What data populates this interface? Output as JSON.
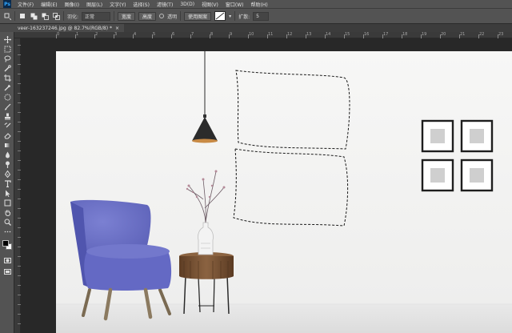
{
  "menu": {
    "logo": "Ps",
    "items": [
      "文件(F)",
      "编辑(E)",
      "图像(I)",
      "图层(L)",
      "文字(Y)",
      "选择(S)",
      "滤镜(T)",
      "3D(D)",
      "视图(V)",
      "窗口(W)",
      "帮助(H)"
    ]
  },
  "options": {
    "feather_label": "羽化:",
    "feather_value": "正常",
    "mode_value": "正常",
    "width_label": "宽度",
    "height_label": "高度",
    "style_label": "透明",
    "pattern_button": "使用图案",
    "spread_label": "扩散:",
    "spread_value": "5"
  },
  "document": {
    "tab_title": "veer-163237246.jpg @ 82.7%(RGB/8) *",
    "close_glyph": "×"
  },
  "ruler": {
    "ticks": [
      "0",
      "1",
      "2",
      "3",
      "4",
      "5",
      "6",
      "7",
      "8",
      "9",
      "10",
      "11",
      "12",
      "13",
      "14",
      "15",
      "16",
      "17",
      "18",
      "19",
      "20",
      "21",
      "22",
      "23",
      "24"
    ]
  },
  "tools": [
    "move-tool",
    "marquee-tool",
    "lasso-tool",
    "quick-select-tool",
    "crop-tool",
    "eyedropper-tool",
    "healing-brush-tool",
    "brush-tool",
    "clone-stamp-tool",
    "history-brush-tool",
    "eraser-tool",
    "gradient-tool",
    "blur-tool",
    "dodge-tool",
    "pen-tool",
    "type-tool",
    "path-select-tool",
    "shape-tool",
    "hand-tool",
    "zoom-tool",
    "more-tools"
  ],
  "colors": {
    "foreground": "#000000",
    "background": "#ffffff",
    "wall": "#f5f5f4",
    "floor": "#e6e6e6",
    "chair": "#6a6fc6",
    "table": "#7a5534"
  }
}
